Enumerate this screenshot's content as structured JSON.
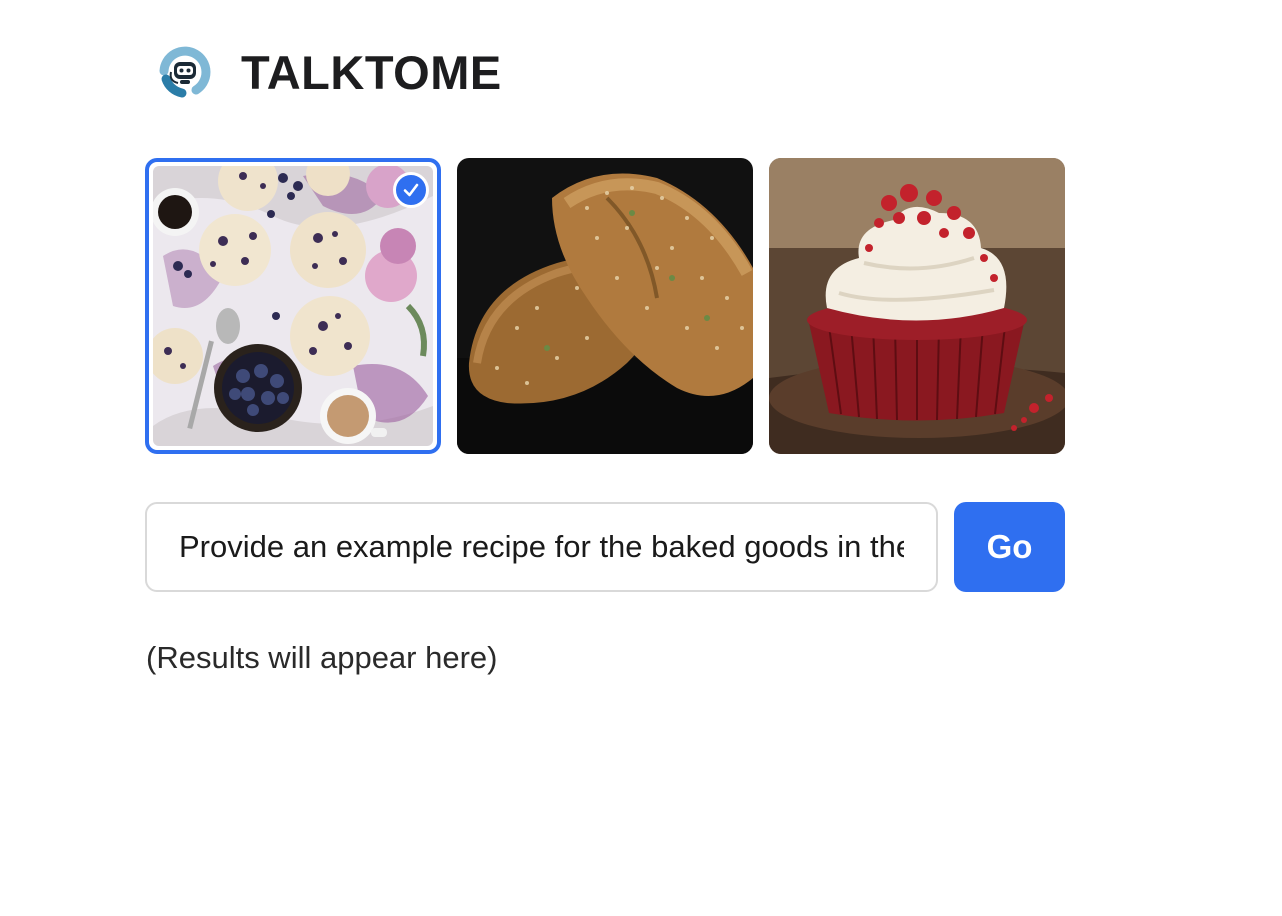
{
  "app": {
    "title": "TALKTOME",
    "logo_icon": "robot-headset-logo-icon"
  },
  "gallery": {
    "images": [
      {
        "subject": "blueberry-scones-image",
        "selected": true
      },
      {
        "subject": "seeded-bread-loaf-image",
        "selected": false
      },
      {
        "subject": "red-velvet-cupcake-image",
        "selected": false
      }
    ],
    "selected_icon": "checkmark-icon"
  },
  "prompt": {
    "value": "Provide an example recipe for the baked goods in the image"
  },
  "go_button": {
    "label": "Go"
  },
  "results": {
    "placeholder": "(Results will appear here)"
  },
  "colors": {
    "accent": "#2f6ff0",
    "title": "#1d1d1f",
    "input_border": "#d9d9d9"
  }
}
